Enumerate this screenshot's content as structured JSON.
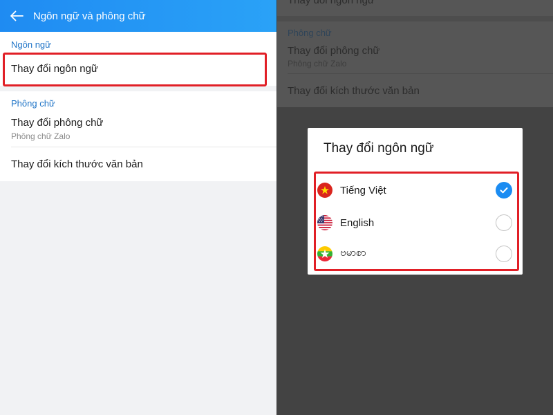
{
  "left": {
    "appbar": {
      "title": "Ngôn ngữ và phông chữ"
    },
    "language_section": {
      "header": "Ngôn ngữ",
      "change_language": "Thay đổi ngôn ngữ"
    },
    "font_section": {
      "header": "Phông chữ",
      "change_font": "Thay đổi phông chữ",
      "change_font_sub": "Phông chữ Zalo",
      "change_text_size": "Thay đổi kích thước văn bản"
    }
  },
  "right": {
    "background": {
      "change_language_partial": "Thay đổi ngôn ngữ",
      "font_header": "Phông chữ",
      "change_font": "Thay đổi phông chữ",
      "change_font_sub": "Phông chữ Zalo",
      "change_text_size": "Thay đổi kích thước văn bản"
    },
    "dialog": {
      "title": "Thay đổi ngôn ngữ",
      "options": [
        {
          "label": "Tiếng Việt",
          "flag": "vietnam-flag-icon",
          "selected": true
        },
        {
          "label": "English",
          "flag": "usa-flag-icon",
          "selected": false
        },
        {
          "label": "ဗမာစာ",
          "flag": "myanmar-flag-icon",
          "selected": false
        }
      ]
    }
  },
  "colors": {
    "accent_blue": "#1f8bf2",
    "section_header_blue": "#1f74c7",
    "highlight_red": "#e11f26",
    "check_blue": "#1b8cf2"
  }
}
